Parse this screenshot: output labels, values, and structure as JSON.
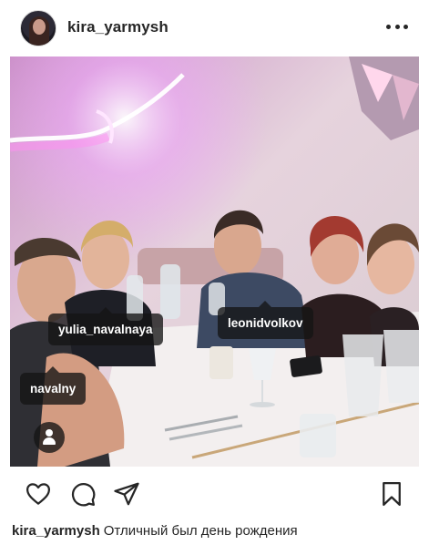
{
  "post": {
    "username": "kira_yarmysh",
    "more_icon": "more-horizontal-icon"
  },
  "photo": {
    "description_icon": "photo",
    "tags": [
      {
        "handle": "yulia_navalnaya"
      },
      {
        "handle": "leonidvolkov"
      },
      {
        "handle": "navalny"
      }
    ],
    "user_tags_icon": "person-icon"
  },
  "actions": {
    "icons": [
      "heart-icon",
      "comment-icon",
      "share-icon",
      "bookmark-icon"
    ]
  },
  "caption": {
    "username": "kira_yarmysh",
    "text": "Отличный был день рождения"
  },
  "colors": {
    "text": "#262626",
    "tag_background": "#141414"
  }
}
